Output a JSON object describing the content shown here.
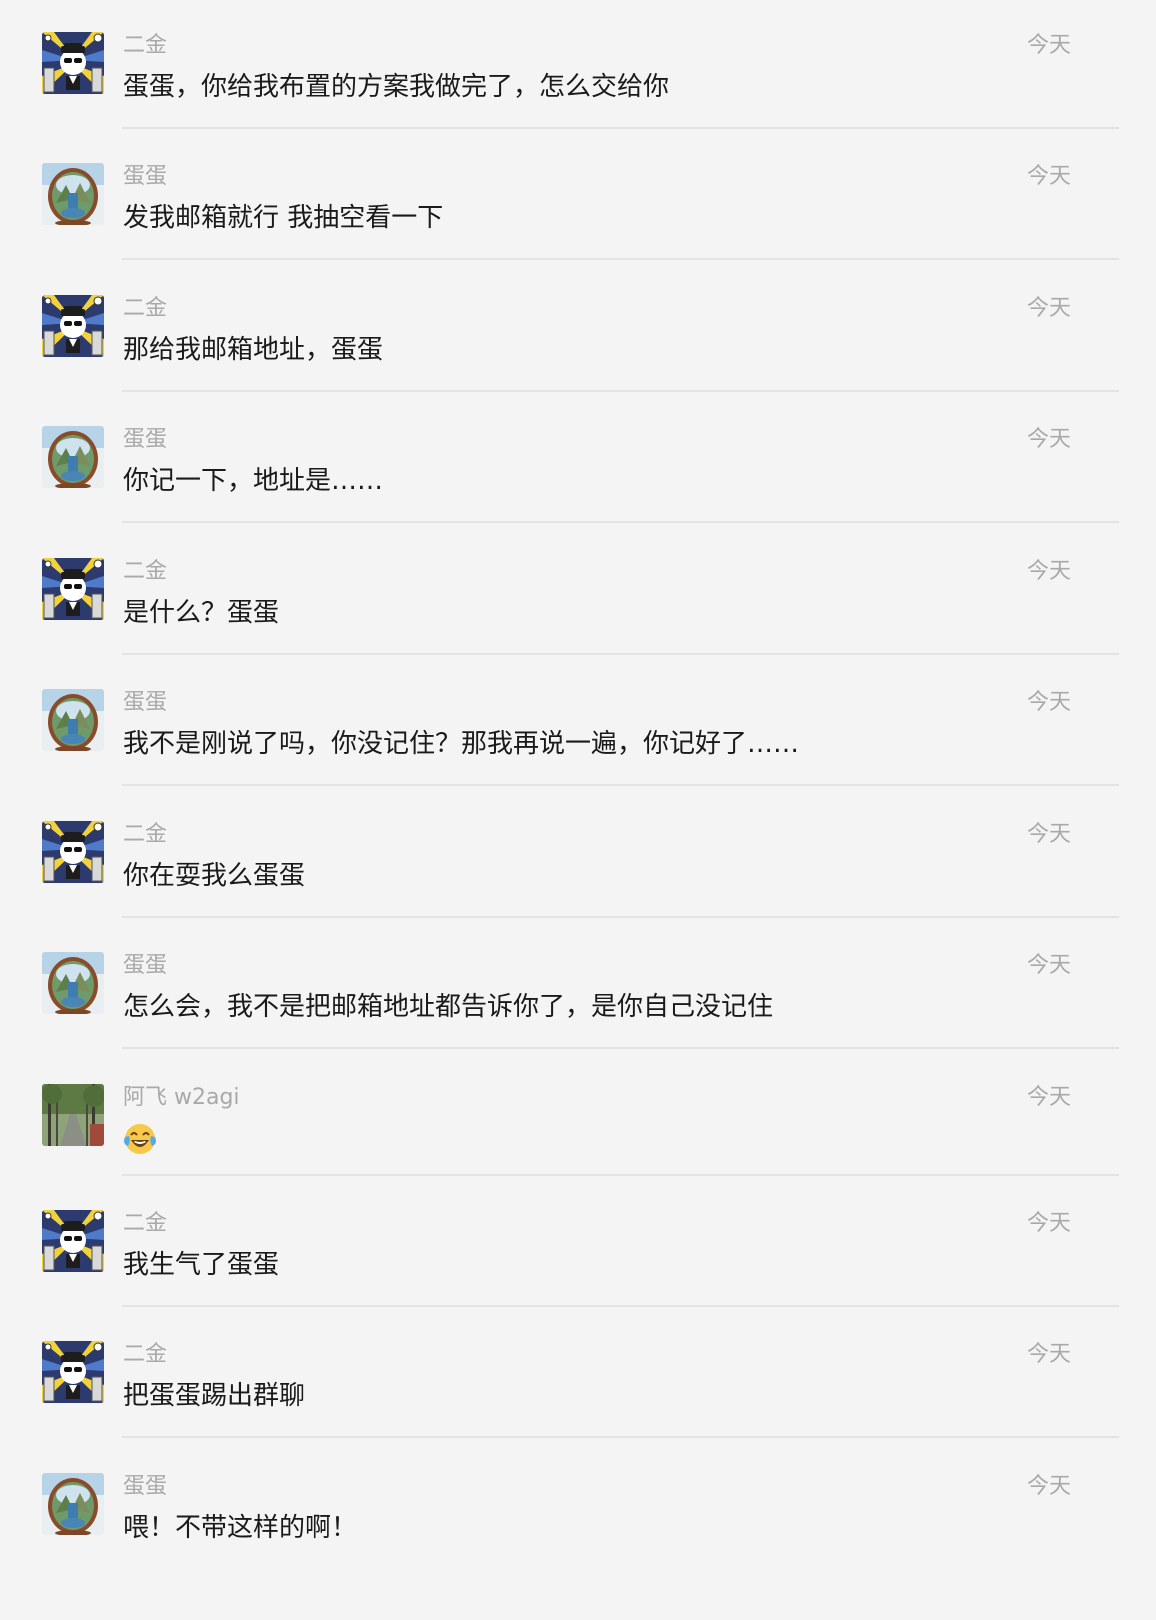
{
  "messages": [
    {
      "sender": "二金",
      "time": "今天",
      "text": "蛋蛋，你给我布置的方案我做完了，怎么交给你",
      "avatar": "erjin-avatar"
    },
    {
      "sender": "蛋蛋",
      "time": "今天",
      "text": "发我邮箱就行  我抽空看一下",
      "avatar": "dandan-avatar"
    },
    {
      "sender": "二金",
      "time": "今天",
      "text": "那给我邮箱地址，蛋蛋",
      "avatar": "erjin-avatar"
    },
    {
      "sender": "蛋蛋",
      "time": "今天",
      "text": "你记一下，地址是……",
      "avatar": "dandan-avatar"
    },
    {
      "sender": "二金",
      "time": "今天",
      "text": "是什么？蛋蛋",
      "avatar": "erjin-avatar"
    },
    {
      "sender": "蛋蛋",
      "time": "今天",
      "text": "我不是刚说了吗，你没记住？那我再说一遍，你记好了……",
      "avatar": "dandan-avatar"
    },
    {
      "sender": "二金",
      "time": "今天",
      "text": "你在耍我么蛋蛋",
      "avatar": "erjin-avatar"
    },
    {
      "sender": "蛋蛋",
      "time": "今天",
      "text": "怎么会，我不是把邮箱地址都告诉你了，是你自己没记住",
      "avatar": "dandan-avatar"
    },
    {
      "sender": "阿飞 w2agi",
      "time": "今天",
      "text": "",
      "emoji": "face-with-tears-of-joy-emoji",
      "avatar": "afei-avatar"
    },
    {
      "sender": "二金",
      "time": "今天",
      "text": "我生气了蛋蛋",
      "avatar": "erjin-avatar"
    },
    {
      "sender": "二金",
      "time": "今天",
      "text": "把蛋蛋踢出群聊",
      "avatar": "erjin-avatar"
    },
    {
      "sender": "蛋蛋",
      "time": "今天",
      "text": "喂！不带这样的啊！",
      "avatar": "dandan-avatar"
    }
  ],
  "colors": {
    "background": "#f4f4f4",
    "meta_text": "#a9a9a9",
    "message_text": "#1a1a1a",
    "divider": "#e3e3e3"
  }
}
